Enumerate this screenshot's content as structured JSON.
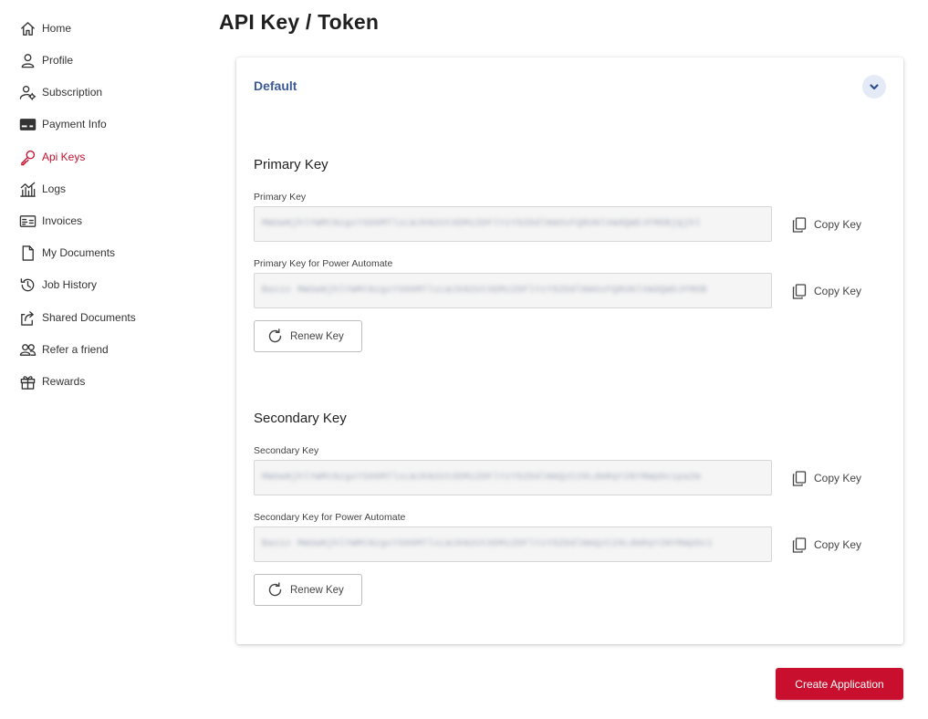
{
  "sidebar": {
    "items": [
      {
        "label": "Home",
        "icon": "home-icon",
        "active": false
      },
      {
        "label": "Profile",
        "icon": "user-icon",
        "active": false
      },
      {
        "label": "Subscription",
        "icon": "user-settings-icon",
        "active": false
      },
      {
        "label": "Payment Info",
        "icon": "credit-card-icon",
        "active": false
      },
      {
        "label": "Api Keys",
        "icon": "key-icon",
        "active": true
      },
      {
        "label": "Logs",
        "icon": "chart-icon",
        "active": false
      },
      {
        "label": "Invoices",
        "icon": "invoice-icon",
        "active": false
      },
      {
        "label": "My Documents",
        "icon": "document-icon",
        "active": false
      },
      {
        "label": "Job History",
        "icon": "history-icon",
        "active": false
      },
      {
        "label": "Shared Documents",
        "icon": "share-icon",
        "active": false
      },
      {
        "label": "Refer a friend",
        "icon": "users-icon",
        "active": false
      },
      {
        "label": "Rewards",
        "icon": "gift-icon",
        "active": false
      }
    ]
  },
  "page": {
    "title": "API Key / Token"
  },
  "card": {
    "title": "Default",
    "collapse_icon": "chevron-down-icon"
  },
  "primary": {
    "section_title": "Primary Key",
    "key_label": "Primary Key",
    "key_value": "MWUwNjhlYWMtNzgxYS00MTlsLWJkN2UtODMzZDFlYzY5ZDdlNmOxFQRUNlVWdQWDJFMDBjQjhl",
    "pa_label": "Primary Key for Power Automate",
    "pa_value": "Basic MWUwNjhlYWMtNzgxYS00MTlsLWJkN2UtODMzZDFlYzY5ZDdlNmOxFQRUNlVWdQWDJFMDB",
    "copy_label": "Copy Key",
    "renew_label": "Renew Key"
  },
  "secondary": {
    "section_title": "Secondary Key",
    "key_label": "Secondary Key",
    "key_value": "MWUwNjhlYWMtNzgxYS00MTlsLWJkN2UtODMzZDFlYzY5ZDdlNmQzC29LdmRqY2NYRWpDc1paZm",
    "pa_label": "Secondary Key for Power Automate",
    "pa_value": "Basic MWUwNjhlYWMtNzgxYS00MTlsLWJkN2UtODMzZDFlYzY5ZDdlNmQzC29LdmRqY2NYRWpDc1",
    "copy_label": "Copy Key",
    "renew_label": "Renew Key"
  },
  "actions": {
    "create_label": "Create Application"
  },
  "colors": {
    "accent_red": "#c8102e",
    "card_title_blue": "#3c5a99"
  }
}
